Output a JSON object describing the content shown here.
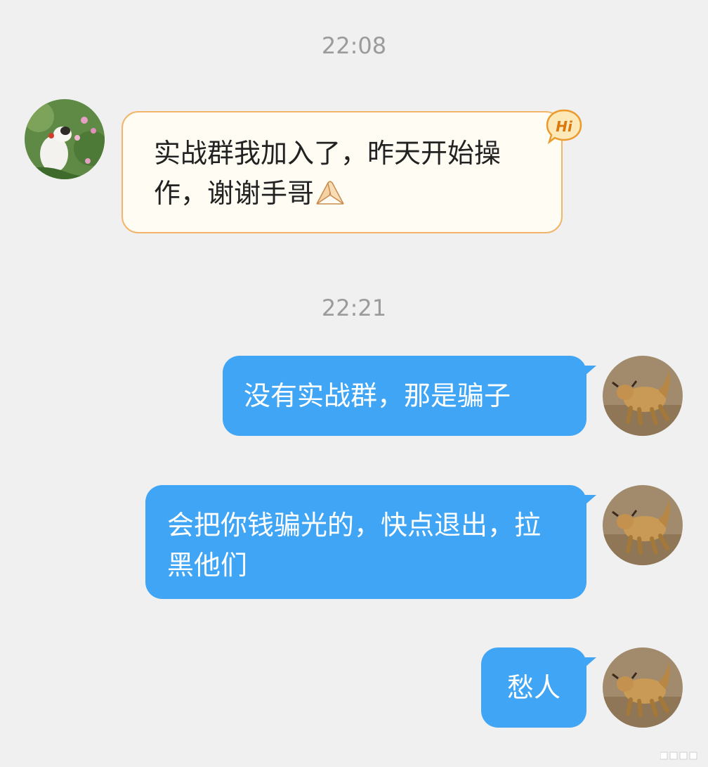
{
  "timestamps": [
    "22:08",
    "22:21"
  ],
  "messages": {
    "incoming": {
      "text": "实战群我加入了，昨天开始操作，谢谢手哥",
      "emoji": "folded-hands-emoji",
      "badge": "Hi"
    },
    "outgoing": [
      {
        "text": "没有实战群，那是骗子"
      },
      {
        "text": "会把你钱骗光的，快点退出，拉黑他们"
      },
      {
        "text": "愁人"
      }
    ]
  },
  "colors": {
    "background": "#f0f0f0",
    "incoming_bubble": "#fffdf3",
    "incoming_border": "#f2b46a",
    "outgoing_bubble": "#40a5f5",
    "timestamp": "#9b9b9b"
  }
}
